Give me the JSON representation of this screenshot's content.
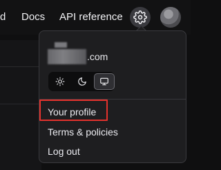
{
  "topbar": {
    "nav_partial": "d",
    "docs": "Docs",
    "api_reference": "API reference"
  },
  "icons": {
    "settings": "gear-icon",
    "avatar": "user-avatar",
    "light": "sun-icon",
    "dark": "moon-icon",
    "system": "monitor-icon"
  },
  "menu": {
    "email_visible": ".com",
    "theme": {
      "options": [
        "light",
        "dark",
        "system"
      ],
      "selected": "system"
    },
    "items": [
      {
        "label": "Your profile",
        "highlighted": true
      },
      {
        "label": "Terms & policies"
      },
      {
        "label": "Log out"
      }
    ]
  },
  "colors": {
    "background": "#0f0f10",
    "menu_bg": "#1e1e20",
    "highlight": "#e5322d"
  }
}
